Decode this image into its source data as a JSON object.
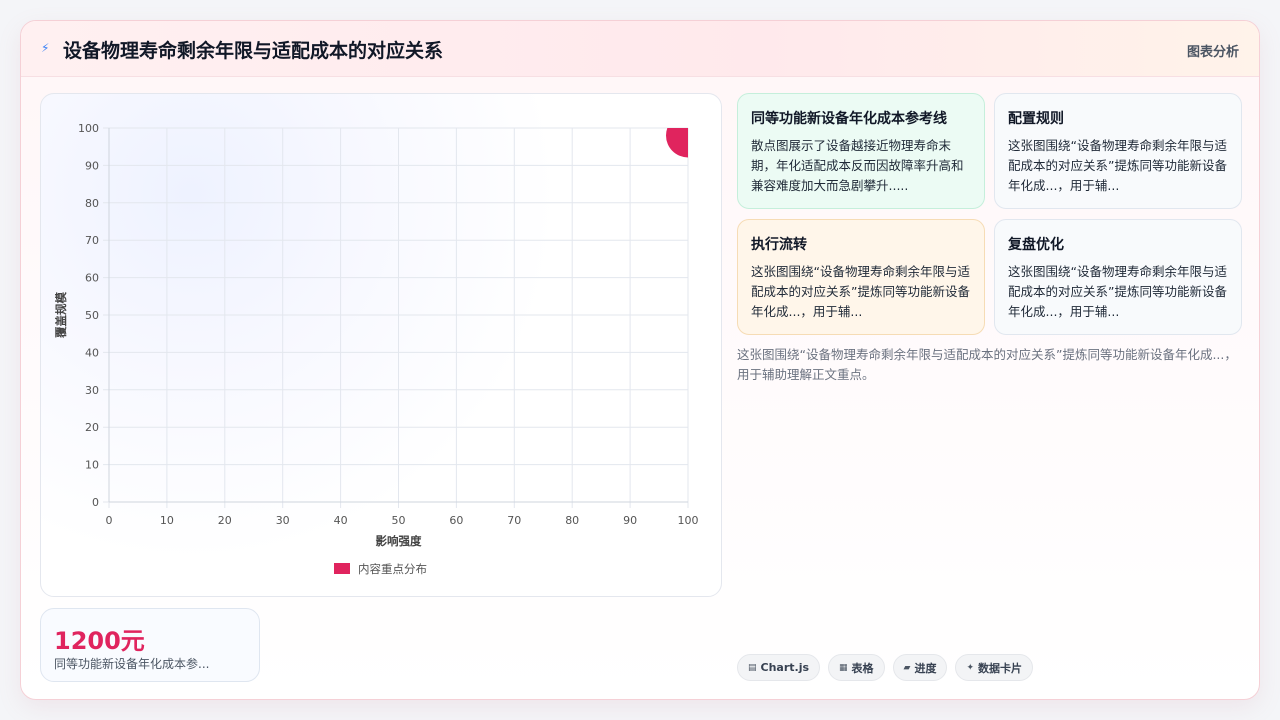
{
  "header": {
    "title": "设备物理寿命剩余年限与适配成本的对应关系",
    "icon": "lightning-icon",
    "tag": "图表分析"
  },
  "chart_data": {
    "type": "scatter",
    "xlabel": "影响强度",
    "ylabel": "覆盖规模",
    "xlim": [
      0,
      100
    ],
    "ylim": [
      0,
      100
    ],
    "xticks": [
      0,
      10,
      20,
      30,
      40,
      50,
      60,
      70,
      80,
      90,
      100
    ],
    "yticks": [
      0,
      10,
      20,
      30,
      40,
      50,
      60,
      70,
      80,
      90,
      100
    ],
    "grid": true,
    "legend_position": "bottom",
    "series": [
      {
        "name": "内容重点分布",
        "color": "#e0245e",
        "points": [
          {
            "x": 100,
            "y": 98
          }
        ]
      }
    ]
  },
  "stat": {
    "value": "1200元",
    "label": "同等功能新设备年化成本参..."
  },
  "cards": [
    {
      "title": "同等功能新设备年化成本参考线",
      "body": "散点图展示了设备越接近物理寿命末期，年化适配成本反而因故障率升高和兼容难度加大而急剧攀升.....",
      "tone": "green"
    },
    {
      "title": "配置规则",
      "body": "这张图围绕“设备物理寿命剩余年限与适配成本的对应关系”提炼同等功能新设备年化成...，用于辅...",
      "tone": "slate"
    },
    {
      "title": "执行流转",
      "body": "这张图围绕“设备物理寿命剩余年限与适配成本的对应关系”提炼同等功能新设备年化成...，用于辅...",
      "tone": "orange"
    },
    {
      "title": "复盘优化",
      "body": "这张图围绕“设备物理寿命剩余年限与适配成本的对应关系”提炼同等功能新设备年化成...，用于辅...",
      "tone": "slate"
    }
  ],
  "summary": "这张图围绕“设备物理寿命剩余年限与适配成本的对应关系”提炼同等功能新设备年化成...，用于辅助理解正文重点。",
  "tags": [
    {
      "label": "Chart.js",
      "icon": "chart-icon"
    },
    {
      "label": "表格",
      "icon": "table-icon"
    },
    {
      "label": "进度",
      "icon": "progress-icon"
    },
    {
      "label": "数据卡片",
      "icon": "sparkle-icon"
    }
  ]
}
